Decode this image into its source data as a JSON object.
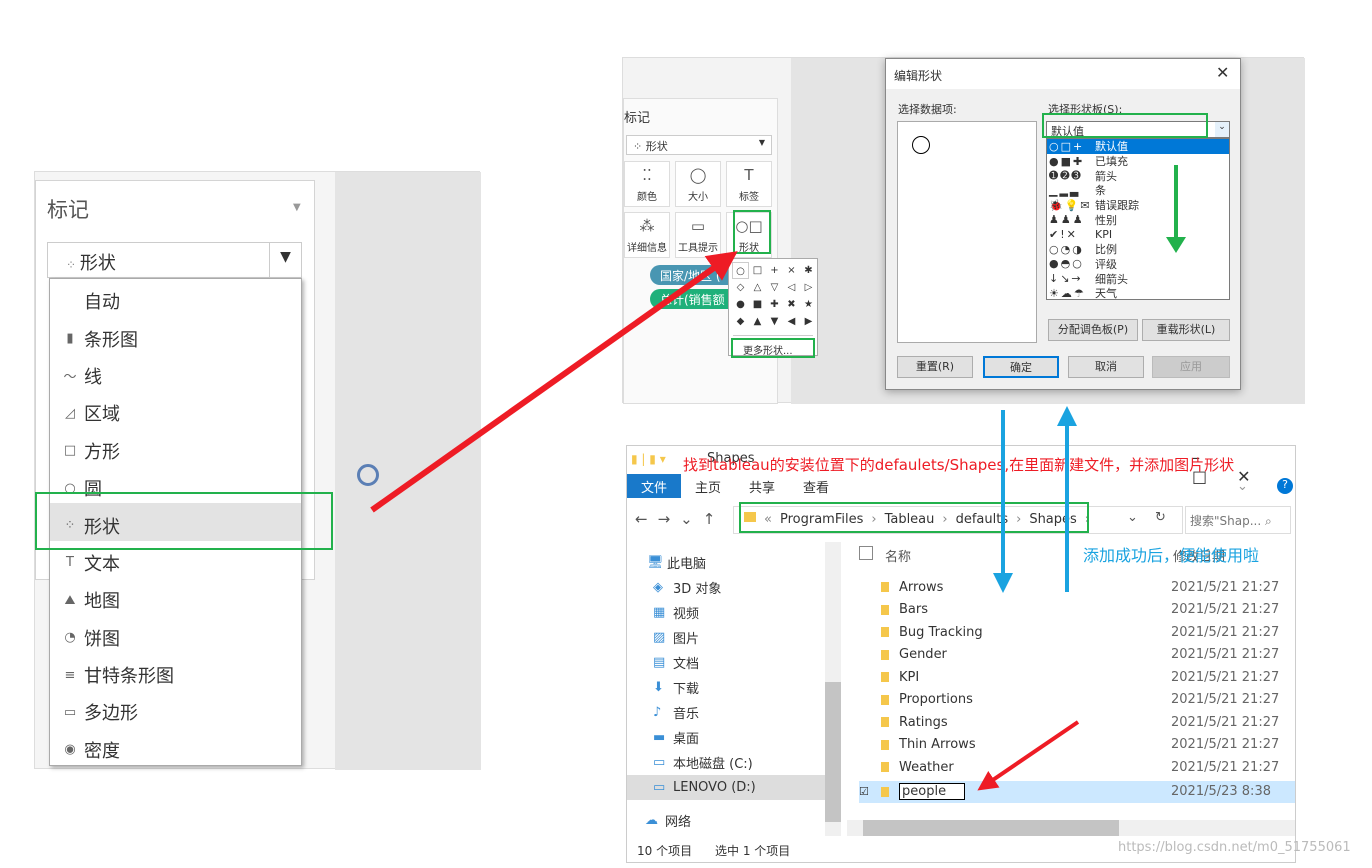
{
  "left_panel": {
    "title": "标记",
    "mark_type_selected": "形状",
    "options": [
      {
        "icon": "auto",
        "label": "自动"
      },
      {
        "icon": "bar-chart-icon",
        "label": "条形图"
      },
      {
        "icon": "line-icon",
        "label": "线"
      },
      {
        "icon": "area-icon",
        "label": "区域"
      },
      {
        "icon": "square-icon",
        "label": "方形"
      },
      {
        "icon": "circle-icon",
        "label": "圆"
      },
      {
        "icon": "shapes-icon",
        "label": "形状",
        "selected": true
      },
      {
        "icon": "text-icon",
        "label": "文本"
      },
      {
        "icon": "map-icon",
        "label": "地图"
      },
      {
        "icon": "pie-icon",
        "label": "饼图"
      },
      {
        "icon": "gantt-icon",
        "label": "甘特条形图"
      },
      {
        "icon": "polygon-icon",
        "label": "多边形"
      },
      {
        "icon": "density-icon",
        "label": "密度"
      }
    ]
  },
  "tableau": {
    "marks_title": "标记",
    "mark_type": "形状",
    "buttons": [
      "颜色",
      "大小",
      "标签",
      "详细信息",
      "工具提示",
      "形状"
    ],
    "pills": [
      "国家/地区 (",
      "总计(销售额"
    ],
    "shape_popup": {
      "symbols": [
        "○",
        "□",
        "+",
        "×",
        "✱",
        "◇",
        "△",
        "▽",
        "◁",
        "▷",
        "●",
        "■",
        "✚",
        "✖",
        "★",
        "◆",
        "▲",
        "▼",
        "◀",
        "▶"
      ],
      "more": "更多形状..."
    }
  },
  "dialog": {
    "title": "编辑形状",
    "data_items_label": "选择数据项:",
    "palette_label": "选择形状板(S):",
    "palette_value": "默认值",
    "palettes": [
      {
        "symbols": "○□+",
        "label": "默认值"
      },
      {
        "symbols": "●■✚",
        "label": "已填充"
      },
      {
        "symbols": "➊➋➌",
        "label": "箭头"
      },
      {
        "symbols": "▁▂▃",
        "label": "条"
      },
      {
        "symbols": "🐞💡✉",
        "label": "错误跟踪"
      },
      {
        "symbols": "♟♟♟",
        "label": "性别"
      },
      {
        "symbols": "✔!✕",
        "label": "KPI"
      },
      {
        "symbols": "○◔◑",
        "label": "比例"
      },
      {
        "symbols": "●◓○",
        "label": "评级"
      },
      {
        "symbols": "↓↘→",
        "label": "细箭头"
      },
      {
        "symbols": "☀☁☂",
        "label": "天气"
      }
    ],
    "assign_palette": "分配调色板(P)",
    "reload_shapes": "重载形状(L)",
    "reset": "重置(R)",
    "ok": "确定",
    "cancel": "取消",
    "apply": "应用"
  },
  "explorer": {
    "title": "Shapes",
    "ribbon": [
      "文件",
      "主页",
      "共享",
      "查看"
    ],
    "path": [
      "ProgramFiles",
      "Tableau",
      "defaults",
      "Shapes"
    ],
    "search_placeholder": "搜索\"Shap...",
    "nav": [
      {
        "icon": "pc-icon",
        "label": "此电脑"
      },
      {
        "icon": "3d-icon",
        "label": "3D 对象"
      },
      {
        "icon": "video-icon",
        "label": "视频"
      },
      {
        "icon": "pictures-icon",
        "label": "图片"
      },
      {
        "icon": "docs-icon",
        "label": "文档"
      },
      {
        "icon": "download-icon",
        "label": "下载"
      },
      {
        "icon": "music-icon",
        "label": "音乐"
      },
      {
        "icon": "desktop-icon",
        "label": "桌面"
      },
      {
        "icon": "drive-icon",
        "label": "本地磁盘 (C:)"
      },
      {
        "icon": "drive-icon",
        "label": "LENOVO (D:)",
        "selected": true
      },
      {
        "icon": "network-icon",
        "label": "网络"
      }
    ],
    "col_name": "名称",
    "col_modified": "修改日期",
    "files": [
      {
        "name": "Arrows",
        "date": "2021/5/21 21:27"
      },
      {
        "name": "Bars",
        "date": "2021/5/21 21:27"
      },
      {
        "name": "Bug Tracking",
        "date": "2021/5/21 21:27"
      },
      {
        "name": "Gender",
        "date": "2021/5/21 21:27"
      },
      {
        "name": "KPI",
        "date": "2021/5/21 21:27"
      },
      {
        "name": "Proportions",
        "date": "2021/5/21 21:27"
      },
      {
        "name": "Ratings",
        "date": "2021/5/21 21:27"
      },
      {
        "name": "Thin Arrows",
        "date": "2021/5/21 21:27"
      },
      {
        "name": "Weather",
        "date": "2021/5/21 21:27"
      },
      {
        "name": "people",
        "date": "2021/5/23 8:38",
        "selected": true
      }
    ],
    "status_count": "10 个项目",
    "status_selected": "选中 1 个项目"
  },
  "annotations": {
    "instruction": "找到tableau的安装位置下的defaulets/Shapes,在里面新建文件，并添加图片形状",
    "success": "添加成功后，便能使用啦"
  },
  "watermark": "https://blog.csdn.net/m0_51755061",
  "colors": {
    "red_arrow": "#ee1c25",
    "green_box": "#22b14c",
    "blue_arrow": "#1aa3e0",
    "accent_blue": "#0078d7"
  }
}
